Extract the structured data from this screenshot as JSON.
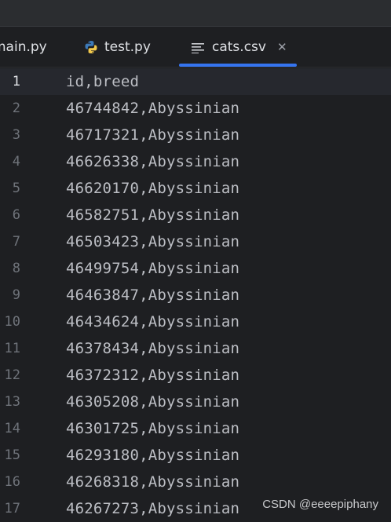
{
  "tabs": [
    {
      "label": "main.py",
      "icon": "python-icon"
    },
    {
      "label": "test.py",
      "icon": "python-icon"
    },
    {
      "label": "cats.csv",
      "icon": "text-file-icon",
      "active": true
    }
  ],
  "editor": {
    "current_line": 1,
    "lines": [
      {
        "num": "1",
        "text": "id,breed"
      },
      {
        "num": "2",
        "text": "46744842,Abyssinian"
      },
      {
        "num": "3",
        "text": "46717321,Abyssinian"
      },
      {
        "num": "4",
        "text": "46626338,Abyssinian"
      },
      {
        "num": "5",
        "text": "46620170,Abyssinian"
      },
      {
        "num": "6",
        "text": "46582751,Abyssinian"
      },
      {
        "num": "7",
        "text": "46503423,Abyssinian"
      },
      {
        "num": "8",
        "text": "46499754,Abyssinian"
      },
      {
        "num": "9",
        "text": "46463847,Abyssinian"
      },
      {
        "num": "10",
        "text": "46434624,Abyssinian"
      },
      {
        "num": "11",
        "text": "46378434,Abyssinian"
      },
      {
        "num": "12",
        "text": "46372312,Abyssinian"
      },
      {
        "num": "13",
        "text": "46305208,Abyssinian"
      },
      {
        "num": "14",
        "text": "46301725,Abyssinian"
      },
      {
        "num": "15",
        "text": "46293180,Abyssinian"
      },
      {
        "num": "16",
        "text": "46268318,Abyssinian"
      },
      {
        "num": "17",
        "text": "46267273,Abyssinian"
      }
    ]
  },
  "watermark": "CSDN @eeeepiphany",
  "colors": {
    "accent": "#3574f0",
    "editor_bg": "#1e1f22",
    "text": "#bcbec4",
    "line_number": "#6f737a"
  }
}
